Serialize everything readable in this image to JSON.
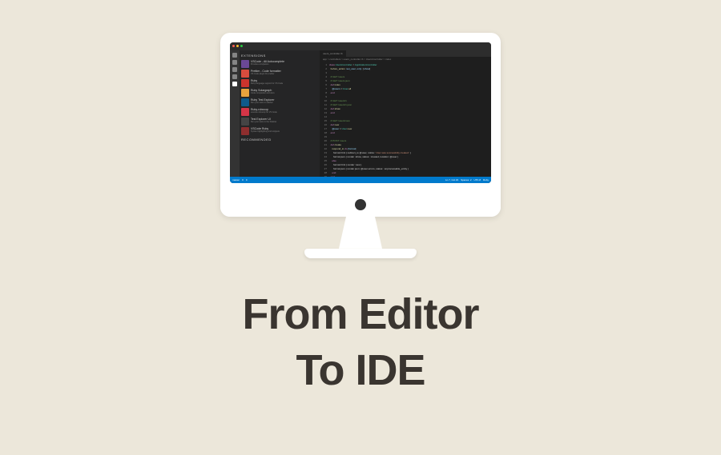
{
  "headline": {
    "line1": "From Editor",
    "line2": "To IDE"
  },
  "editor": {
    "sidebar_header": "EXTENSIONS",
    "tab_name": "users_controller.rb",
    "breadcrumb": "app > controllers > users_controller.rb > UsersController > index",
    "extensions": [
      {
        "name": "VSCode - All Autocomplete",
        "desc": "Provides completion",
        "color": "#6b4896"
      },
      {
        "name": "Prettier - Code formatter",
        "desc": "VS Code plugin for prettier",
        "color": "#d84c3e"
      },
      {
        "name": "Ruby",
        "desc": "Ruby language support for VS Code",
        "color": "#cc342d"
      },
      {
        "name": "Ruby Solargraph",
        "desc": "Code completion and docs",
        "color": "#e8a33d"
      },
      {
        "name": "Ruby Test Explorer",
        "desc": "Run your tests in sidebar",
        "color": "#0e5a8a"
      },
      {
        "name": "Ruby-rubocop",
        "desc": "execute rubocop for VS Code",
        "color": "#d43547"
      },
      {
        "name": "Test Explorer UI",
        "desc": "Run your tests in the Sidebar",
        "color": "#444444"
      },
      {
        "name": "VSCode Ruby",
        "desc": "Syntax highlighting and snippets",
        "color": "#8e2e2e"
      }
    ],
    "recommended_header": "RECOMMENDED",
    "code_lines": [
      {
        "num": "1",
        "content": [
          {
            "t": "class ",
            "c": "kw"
          },
          {
            "t": "UsersController ",
            "c": "ty"
          },
          {
            "t": "< ",
            "c": "pl"
          },
          {
            "t": "ApplicationController",
            "c": "ty"
          }
        ]
      },
      {
        "num": "2",
        "content": [
          {
            "t": "  before_action ",
            "c": "fn"
          },
          {
            "t": ":set_user",
            "c": "va"
          },
          {
            "t": ", ",
            "c": "pl"
          },
          {
            "t": "only: ",
            "c": "va"
          },
          {
            "t": "[",
            "c": "pl"
          },
          {
            "t": ":show",
            "c": "va"
          },
          {
            "t": "]",
            "c": "pl"
          }
        ]
      },
      {
        "num": "3",
        "content": []
      },
      {
        "num": "4",
        "content": [
          {
            "t": "  # GET /users",
            "c": "cm"
          }
        ]
      },
      {
        "num": "5",
        "content": [
          {
            "t": "  # GET /users.json",
            "c": "cm"
          }
        ]
      },
      {
        "num": "6",
        "content": [
          {
            "t": "  def ",
            "c": "kw"
          },
          {
            "t": "index",
            "c": "fn"
          }
        ]
      },
      {
        "num": "7",
        "content": [
          {
            "t": "    @users ",
            "c": "va"
          },
          {
            "t": "= ",
            "c": "pl"
          },
          {
            "t": "User",
            "c": "ty"
          },
          {
            "t": ".all",
            "c": "fn"
          }
        ]
      },
      {
        "num": "8",
        "content": [
          {
            "t": "  end",
            "c": "kw"
          }
        ]
      },
      {
        "num": "9",
        "content": []
      },
      {
        "num": "10",
        "content": [
          {
            "t": "  # GET /users/1",
            "c": "cm"
          }
        ]
      },
      {
        "num": "11",
        "content": [
          {
            "t": "  # GET /users/1.json",
            "c": "cm"
          }
        ]
      },
      {
        "num": "12",
        "content": [
          {
            "t": "  def ",
            "c": "kw"
          },
          {
            "t": "show",
            "c": "fn"
          }
        ]
      },
      {
        "num": "13",
        "content": [
          {
            "t": "  end",
            "c": "kw"
          }
        ]
      },
      {
        "num": "14",
        "content": []
      },
      {
        "num": "15",
        "content": [
          {
            "t": "  # GET /users/new",
            "c": "cm"
          }
        ]
      },
      {
        "num": "16",
        "content": [
          {
            "t": "  def ",
            "c": "kw"
          },
          {
            "t": "new",
            "c": "fn"
          }
        ]
      },
      {
        "num": "17",
        "content": [
          {
            "t": "    @user ",
            "c": "va"
          },
          {
            "t": "= ",
            "c": "pl"
          },
          {
            "t": "User",
            "c": "ty"
          },
          {
            "t": ".new",
            "c": "fn"
          }
        ]
      },
      {
        "num": "18",
        "content": [
          {
            "t": "  end",
            "c": "kw"
          }
        ]
      },
      {
        "num": "19",
        "content": []
      },
      {
        "num": "20",
        "content": [
          {
            "t": "  # POST /users",
            "c": "cm"
          }
        ]
      },
      {
        "num": "21",
        "content": [
          {
            "t": "  def ",
            "c": "kw"
          },
          {
            "t": "create",
            "c": "fn"
          }
        ]
      },
      {
        "num": "22",
        "content": [
          {
            "t": "    respond_to ",
            "c": "fn"
          },
          {
            "t": "do ",
            "c": "kw"
          },
          {
            "t": "|format|",
            "c": "va"
          }
        ]
      },
      {
        "num": "23",
        "content": [
          {
            "t": "      format.html { redirect_to @user, notice: ",
            "c": "pl"
          },
          {
            "t": "'User was successfully created.'",
            "c": "str"
          },
          {
            "t": " }",
            "c": "pl"
          }
        ]
      },
      {
        "num": "24",
        "content": [
          {
            "t": "      format.json { render :show, status: :created, location: @user }",
            "c": "pl"
          }
        ]
      },
      {
        "num": "25",
        "content": [
          {
            "t": "    else",
            "c": "kw"
          }
        ]
      },
      {
        "num": "26",
        "content": [
          {
            "t": "      format.html { render :new }",
            "c": "pl"
          }
        ]
      },
      {
        "num": "27",
        "content": [
          {
            "t": "      format.json { render json: @user.errors, status: :unprocessable_entity }",
            "c": "pl"
          }
        ]
      },
      {
        "num": "28",
        "content": [
          {
            "t": "    end",
            "c": "kw"
          }
        ]
      },
      {
        "num": "29",
        "content": [
          {
            "t": "  end",
            "c": "kw"
          }
        ]
      }
    ],
    "status": {
      "left": [
        "master",
        "0",
        "0"
      ],
      "right": [
        "Ln 7, Col 23",
        "Spaces: 2",
        "UTF-8",
        "Ruby"
      ]
    }
  }
}
